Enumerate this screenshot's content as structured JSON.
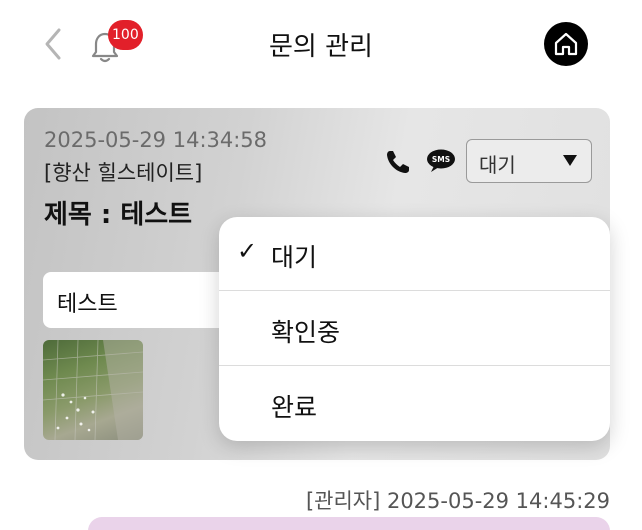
{
  "header": {
    "title": "문의 관리",
    "notification_count": "100",
    "back_icon": "chevron-left-icon",
    "bell_icon": "bell-icon",
    "home_icon": "home-icon"
  },
  "inquiry": {
    "datetime": "2025-05-29 14:34:58",
    "complex": "[향산 힐스테이트]",
    "subject": "제목 : 테스트",
    "content": "테스트",
    "status_selected": "대기"
  },
  "status_menu": {
    "options": [
      {
        "label": "대기",
        "checked": "✓"
      },
      {
        "label": "확인중",
        "checked": ""
      },
      {
        "label": "완료",
        "checked": ""
      }
    ]
  },
  "reply": {
    "meta": "[관리자] 2025-05-29 14:45:29"
  },
  "colors": {
    "badge": "#e2202a",
    "reply_bubble": "#ead3ea",
    "card_bg": "#d2d2d2"
  }
}
